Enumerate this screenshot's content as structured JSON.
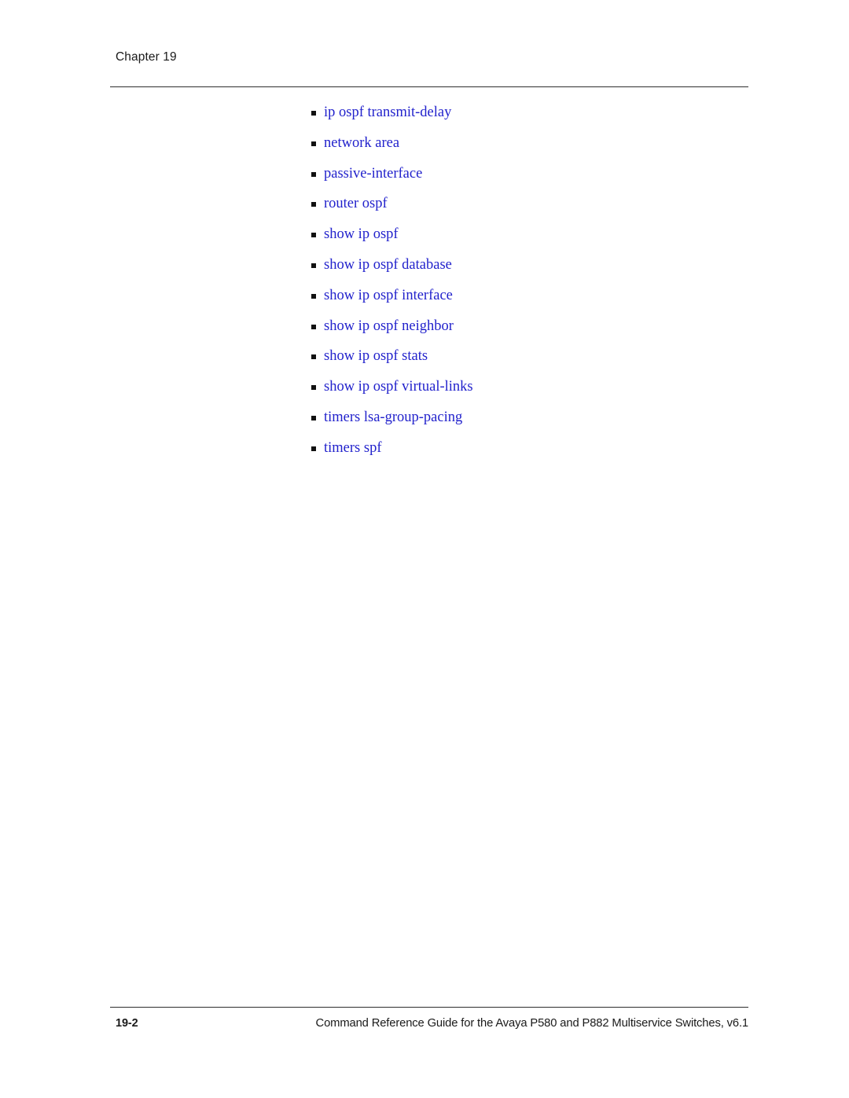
{
  "header": {
    "chapter_label": "Chapter 19"
  },
  "colors": {
    "link_blue": "#2222cc",
    "rule_gray": "#2e2e2e",
    "text_black": "#1a1a1a",
    "page_background": "#ffffff"
  },
  "main": {
    "bullet_glyph": "square",
    "commands": [
      {
        "label": "ip ospf transmit-delay"
      },
      {
        "label": "network area"
      },
      {
        "label": "passive-interface"
      },
      {
        "label": "router ospf"
      },
      {
        "label": "show ip ospf"
      },
      {
        "label": "show ip ospf database"
      },
      {
        "label": "show ip ospf interface"
      },
      {
        "label": "show ip ospf neighbor"
      },
      {
        "label": "show ip ospf stats"
      },
      {
        "label": "show ip ospf virtual-links"
      },
      {
        "label": "timers lsa-group-pacing"
      },
      {
        "label": "timers spf"
      }
    ]
  },
  "footer": {
    "page_number": "19-2",
    "title": "Command Reference Guide for the Avaya P580 and P882 Multiservice Switches, v6.1"
  }
}
